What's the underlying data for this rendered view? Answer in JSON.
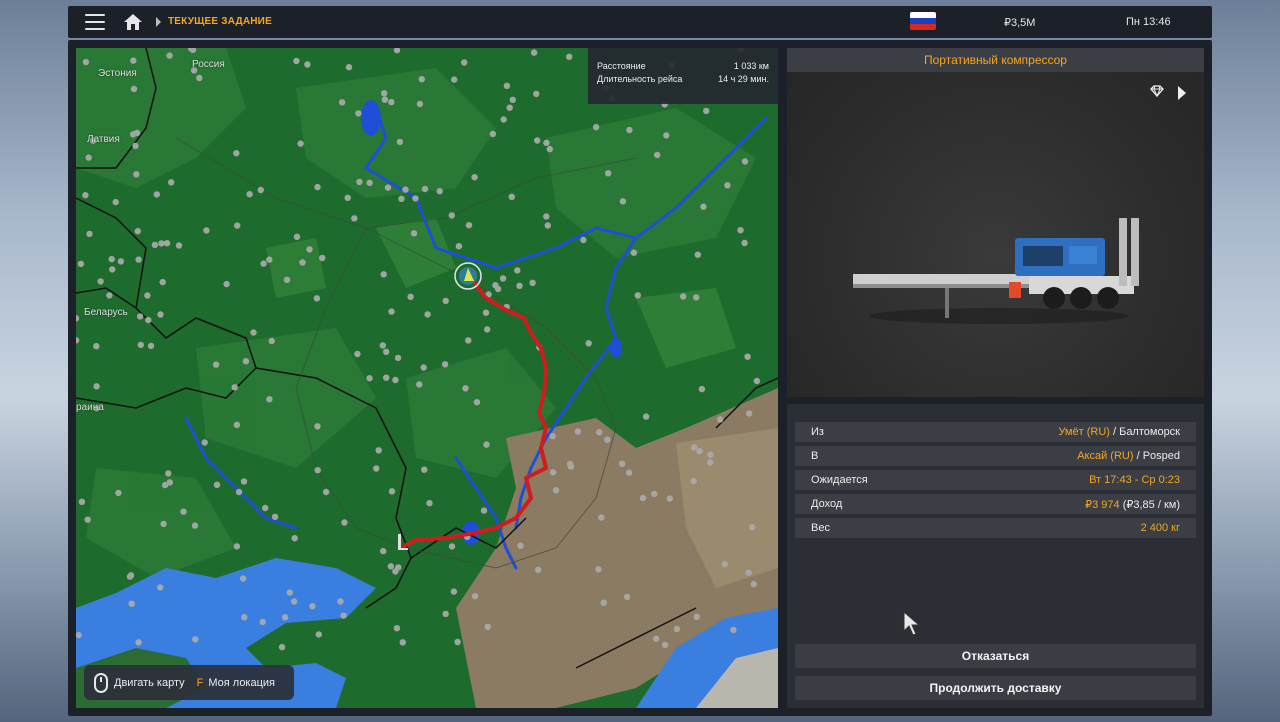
{
  "header": {
    "breadcrumb": "ТЕКУЩЕЕ ЗАДАНИЕ",
    "money": "₽3,5M",
    "clock": "Пн 13:46",
    "icons": [
      "menu-icon",
      "home-icon",
      "flag-russia-icon"
    ]
  },
  "map": {
    "info": {
      "distance_label": "Расстояние",
      "distance_value": "1 033 км",
      "duration_label": "Длительность рейса",
      "duration_value": "14 ч 29 мин."
    },
    "labels": {
      "estonia": "Эстония",
      "russia": "Россия",
      "latvia": "Латвия",
      "belarus": "Беларусь",
      "ukraine": "раина"
    },
    "hints": {
      "move": "Двигать карту",
      "key": "F",
      "location": "Моя локация"
    },
    "colors": {
      "land": "#1e6b2e",
      "water": "#3a7ee0",
      "route": "#d01c1c",
      "steppe": "#8a7b62"
    }
  },
  "cargo": {
    "name": "Портативный компрессор",
    "icons": [
      "diamond-icon",
      "next-arrow-icon"
    ]
  },
  "details": {
    "from_label": "Из",
    "from_city": "Умёт (RU)",
    "from_company": "/ Балтоморск",
    "to_label": "В",
    "to_city": "Аксай (RU)",
    "to_company": "/ Posped",
    "expected_label": "Ожидается",
    "expected_value": "Вт 17:43 - Ср 0:23",
    "income_label": "Доход",
    "income_value": "₽3 974",
    "income_rate": "(₽3,85 / км)",
    "weight_label": "Вес",
    "weight_value": "2 400 кг"
  },
  "actions": {
    "cancel": "Отказаться",
    "continue": "Продолжить доставку"
  },
  "accent_color": "#f5a623"
}
